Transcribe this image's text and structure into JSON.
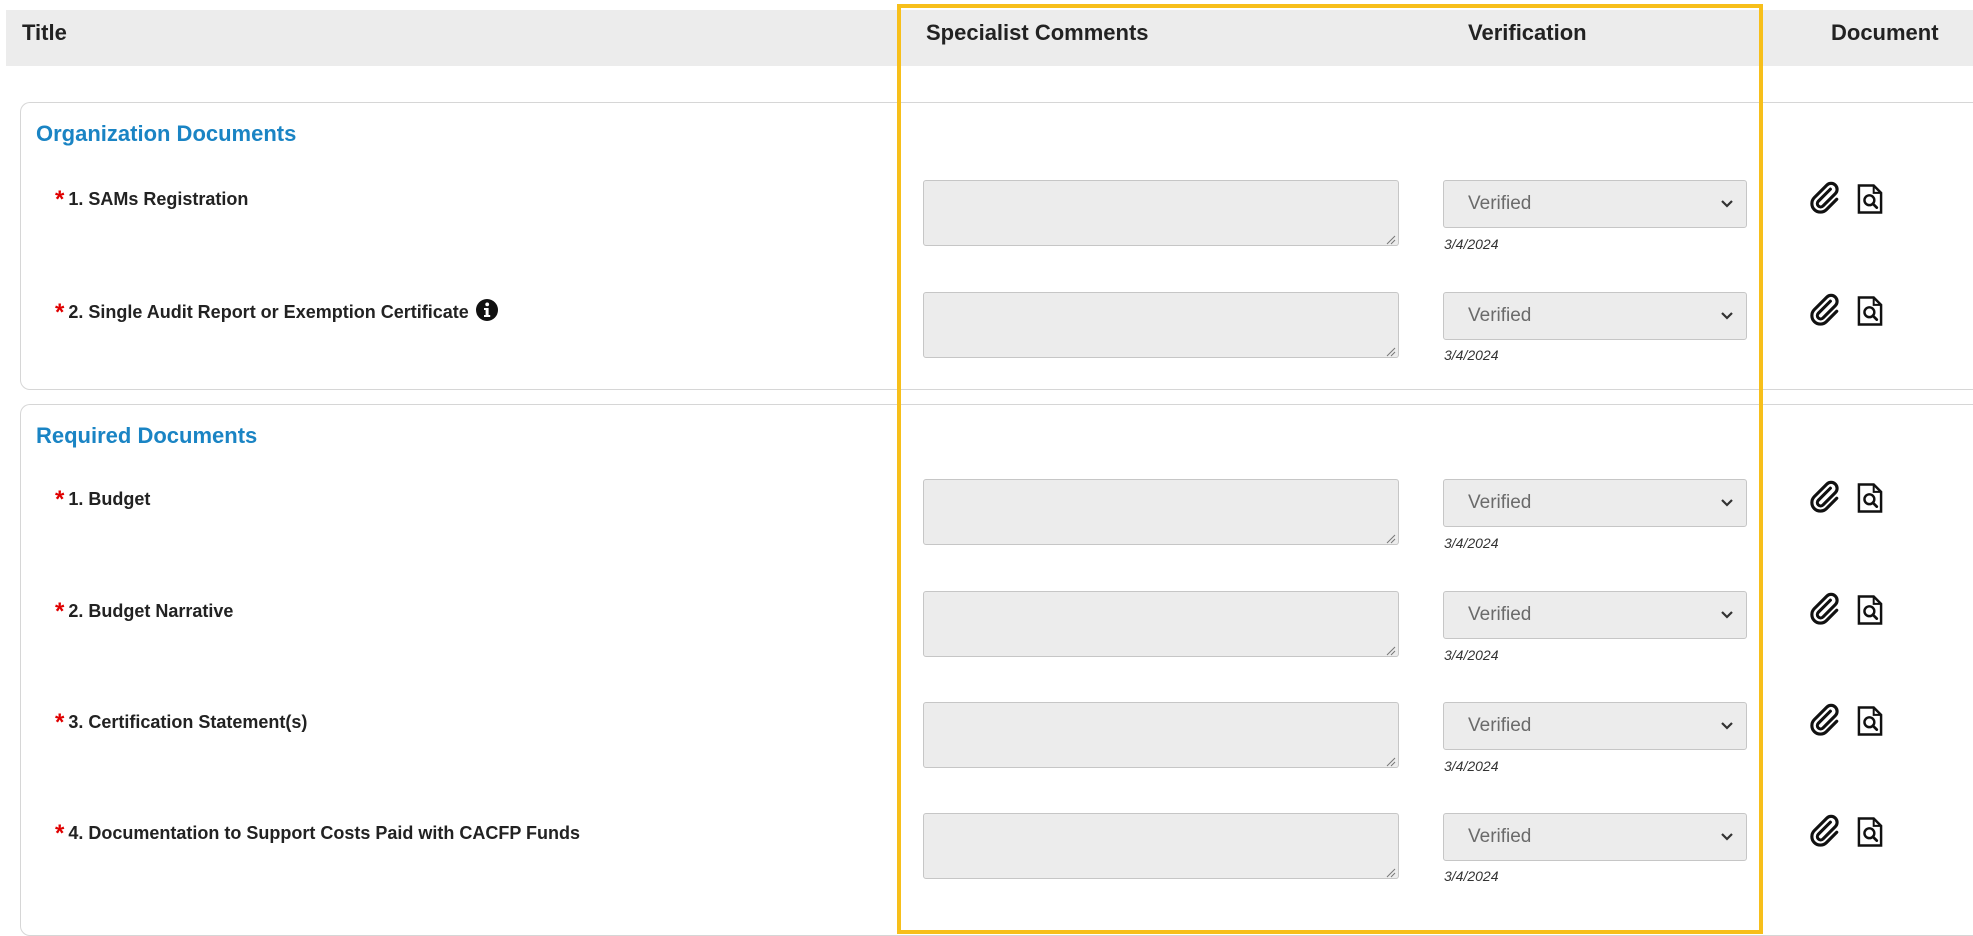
{
  "header": {
    "title": "Title",
    "specialist_comments": "Specialist Comments",
    "verification": "Verification",
    "document": "Document"
  },
  "sections": [
    {
      "title": "Organization Documents",
      "rows": [
        {
          "label": "1. SAMs Registration",
          "required": true,
          "info_icon": false,
          "comment": "",
          "verification": "Verified",
          "date": "3/4/2024"
        },
        {
          "label": "2. Single Audit Report or Exemption Certificate",
          "required": true,
          "info_icon": true,
          "comment": "",
          "verification": "Verified",
          "date": "3/4/2024"
        }
      ]
    },
    {
      "title": "Required Documents",
      "rows": [
        {
          "label": "1. Budget",
          "required": true,
          "info_icon": false,
          "comment": "",
          "verification": "Verified",
          "date": "3/4/2024"
        },
        {
          "label": "2. Budget Narrative",
          "required": true,
          "info_icon": false,
          "comment": "",
          "verification": "Verified",
          "date": "3/4/2024"
        },
        {
          "label": "3. Certification Statement(s)",
          "required": true,
          "info_icon": false,
          "comment": "",
          "verification": "Verified",
          "date": "3/4/2024"
        },
        {
          "label": "4. Documentation to Support Costs Paid with CACFP Funds",
          "required": true,
          "info_icon": false,
          "comment": "",
          "verification": "Verified",
          "date": "3/4/2024"
        }
      ]
    }
  ],
  "required_marker": "*",
  "icons": {
    "info": "info-circle-icon",
    "attach": "paperclip-icon",
    "view": "document-search-icon",
    "dropdown": "chevron-down-icon"
  },
  "colors": {
    "section_title": "#1a84c4",
    "required_marker": "#e00000",
    "highlight": "#f7bf1a",
    "header_bg": "#ececec"
  }
}
